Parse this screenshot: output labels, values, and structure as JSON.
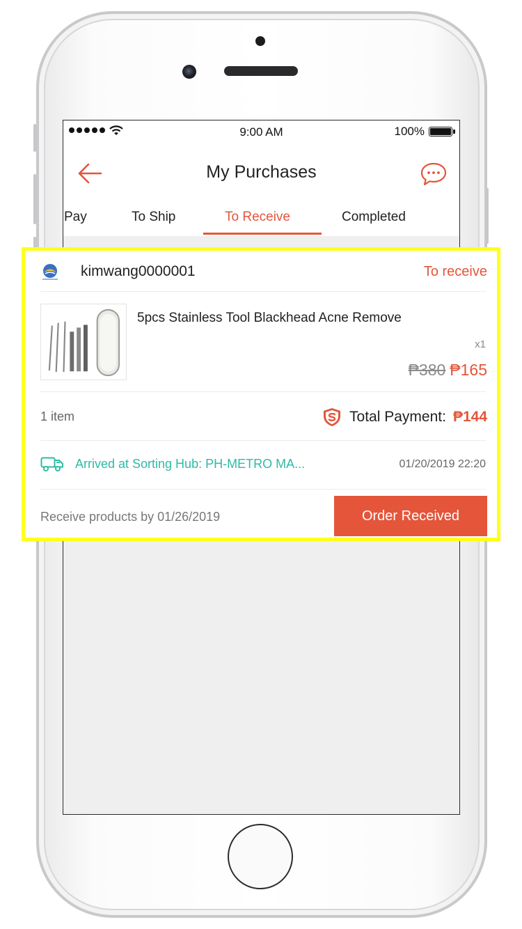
{
  "status_bar": {
    "time": "9:00 AM",
    "battery": "100%"
  },
  "header": {
    "title": "My Purchases"
  },
  "tabs": [
    {
      "label": "Pay"
    },
    {
      "label": "To Ship"
    },
    {
      "label": "To Receive",
      "active": true
    },
    {
      "label": "Completed"
    }
  ],
  "order": {
    "shop_name": "kimwang0000001",
    "status": "To receive",
    "product_name": "5pcs Stainless Tool Blackhead Acne Remove",
    "quantity": "x1",
    "original_price": "₱380",
    "price": "₱165",
    "item_count": "1 item",
    "total_label": "Total Payment:",
    "total_amount": "₱144",
    "tracking_status": "Arrived at Sorting Hub: PH-METRO MA...",
    "tracking_time": "01/20/2019 22:20",
    "receive_by": "Receive products by 01/26/2019",
    "action_button": "Order Received"
  },
  "colors": {
    "accent": "#e4553a",
    "tracking": "#2dbba4",
    "highlight": "#ffff1a"
  },
  "icons": [
    "back-arrow-icon",
    "chat-icon",
    "shop-logo-icon",
    "shield-icon",
    "truck-icon",
    "wifi-icon",
    "battery-icon",
    "signal-icon"
  ]
}
